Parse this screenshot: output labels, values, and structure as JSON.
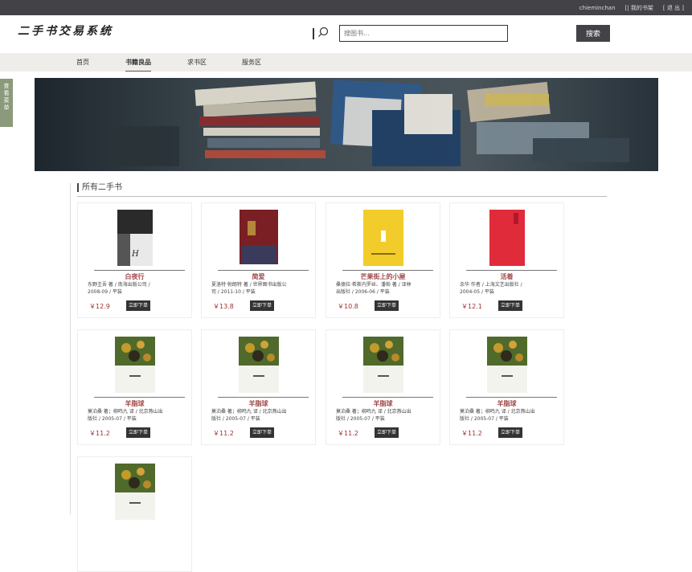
{
  "topbar": {
    "username": "chieminchan",
    "my_books": "[| 我的书架",
    "logout": "[ 退 出 ]"
  },
  "header": {
    "logo": "二手书交易系统",
    "search_placeholder": "搜图书...",
    "search_button": "搜索"
  },
  "nav": {
    "items": [
      "首页",
      "书籍良品",
      "求书区",
      "服务区"
    ],
    "active": "书籍良品"
  },
  "side_tab": {
    "label": "查看菜单"
  },
  "section": {
    "title": "所有二手书"
  },
  "books": [
    {
      "title": "白夜行",
      "meta": "东野圭吾 著 / 南海出版公司 / 2008-09 / 平装",
      "price": "￥12.9",
      "buy": "立即下单",
      "cover": "byx"
    },
    {
      "title": "简爱",
      "meta": "夏洛特·勃朗特 著 / 世界图书出版公司 / 2011-10 / 平装",
      "price": "￥13.8",
      "buy": "立即下单",
      "cover": "ja"
    },
    {
      "title": "芒果街上的小屋",
      "meta": "桑德拉·希斯内罗丝、潘帕 著 / 译林出版社 / 2006-06 / 平装",
      "price": "￥10.8",
      "buy": "立即下单",
      "cover": "mg"
    },
    {
      "title": "活着",
      "meta": "余华 作者 / 上海文艺出版社 / 2004-05 / 平装",
      "price": "￥12.1",
      "buy": "立即下单",
      "cover": "hz"
    },
    {
      "title": "羊脂球",
      "meta": "莫泊桑 著；柳鸣九 译 / 北京燕山出版社 / 2005-07 / 平装",
      "price": "￥11.2",
      "buy": "立即下单",
      "cover": "yzq"
    },
    {
      "title": "羊脂球",
      "meta": "莫泊桑 著；柳鸣九 译 / 北京燕山出版社 / 2005-07 / 平装",
      "price": "￥11.2",
      "buy": "立即下单",
      "cover": "yzq"
    },
    {
      "title": "羊脂球",
      "meta": "莫泊桑 著；柳鸣九 译 / 北京燕山出版社 / 2005-07 / 平装",
      "price": "￥11.2",
      "buy": "立即下单",
      "cover": "yzq"
    },
    {
      "title": "羊脂球",
      "meta": "莫泊桑 著；柳鸣九 译 / 北京燕山出版社 / 2005-07 / 平装",
      "price": "￥11.2",
      "buy": "立即下单",
      "cover": "yzq"
    },
    {
      "title": "",
      "meta": "",
      "price": "",
      "buy": "",
      "cover": "yzq"
    }
  ],
  "colors": {
    "topbar": "#424247",
    "nav_bg": "#eeede9",
    "title": "#a04848",
    "price": "#a03030",
    "side_tab": "#8a9a7a"
  }
}
